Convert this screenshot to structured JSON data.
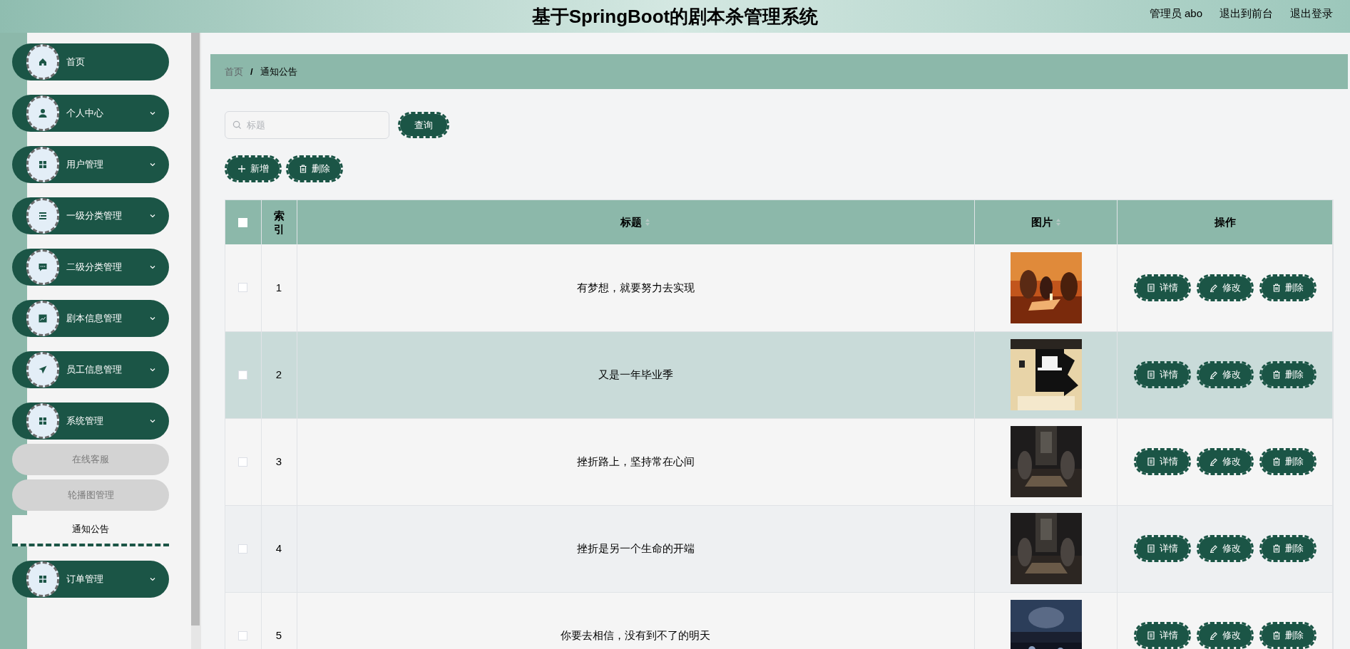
{
  "header": {
    "title": "基于SpringBoot的剧本杀管理系统",
    "links": [
      {
        "label": "管理员 abo"
      },
      {
        "label": "退出到前台"
      },
      {
        "label": "退出登录"
      }
    ]
  },
  "sidebar": {
    "items": [
      {
        "label": "首页",
        "kind": "link"
      },
      {
        "label": "个人中心",
        "kind": "group"
      },
      {
        "label": "用户管理",
        "kind": "group"
      },
      {
        "label": "一级分类管理",
        "kind": "group"
      },
      {
        "label": "二级分类管理",
        "kind": "group"
      },
      {
        "label": "剧本信息管理",
        "kind": "group"
      },
      {
        "label": "员工信息管理",
        "kind": "group"
      },
      {
        "label": "系统管理",
        "kind": "group",
        "expanded": true,
        "children": [
          {
            "label": "在线客服",
            "selected": false
          },
          {
            "label": "轮播图管理",
            "selected": false
          },
          {
            "label": "通知公告",
            "selected": true
          }
        ]
      },
      {
        "label": "订单管理",
        "kind": "group"
      }
    ]
  },
  "breadcrumb": {
    "separator": "/",
    "items": [
      {
        "label": "首页"
      },
      {
        "label": "通知公告"
      }
    ]
  },
  "search": {
    "placeholder": "标题",
    "button": "查询"
  },
  "actions": [
    {
      "label": "新增",
      "kind": "add"
    },
    {
      "label": "删除",
      "kind": "delete"
    }
  ],
  "table": {
    "select_all": {
      "checked": false
    },
    "columns": [
      {
        "label": "索引",
        "kind": "plain"
      },
      {
        "label": "标题",
        "kind": "sortable"
      },
      {
        "label": "图片",
        "kind": "sortable"
      },
      {
        "label": "操作",
        "kind": "plain"
      }
    ],
    "rows": [
      {
        "checked": false,
        "index": "1",
        "title": "有梦想，就要努力去实现",
        "highlighted": false,
        "buttons": [
          {
            "label": "详情",
            "kind": "detail"
          },
          {
            "label": "修改",
            "kind": "edit"
          },
          {
            "label": "删除",
            "kind": "delete"
          }
        ]
      },
      {
        "checked": false,
        "index": "2",
        "title": "又是一年毕业季",
        "highlighted": true,
        "buttons": [
          {
            "label": "详情",
            "kind": "detail"
          },
          {
            "label": "修改",
            "kind": "edit"
          },
          {
            "label": "删除",
            "kind": "delete"
          }
        ]
      },
      {
        "checked": false,
        "index": "3",
        "title": "挫折路上，坚持常在心间",
        "highlighted": false,
        "buttons": [
          {
            "label": "详情",
            "kind": "detail"
          },
          {
            "label": "修改",
            "kind": "edit"
          },
          {
            "label": "删除",
            "kind": "delete"
          }
        ]
      },
      {
        "checked": false,
        "index": "4",
        "title": "挫折是另一个生命的开端",
        "highlighted": false,
        "buttons": [
          {
            "label": "详情",
            "kind": "detail"
          },
          {
            "label": "修改",
            "kind": "edit"
          },
          {
            "label": "删除",
            "kind": "delete"
          }
        ]
      },
      {
        "checked": false,
        "index": "5",
        "title": "你要去相信，没有到不了的明天",
        "highlighted": false,
        "buttons": [
          {
            "label": "详情",
            "kind": "detail"
          },
          {
            "label": "修改",
            "kind": "edit"
          },
          {
            "label": "删除",
            "kind": "delete"
          }
        ]
      }
    ]
  }
}
